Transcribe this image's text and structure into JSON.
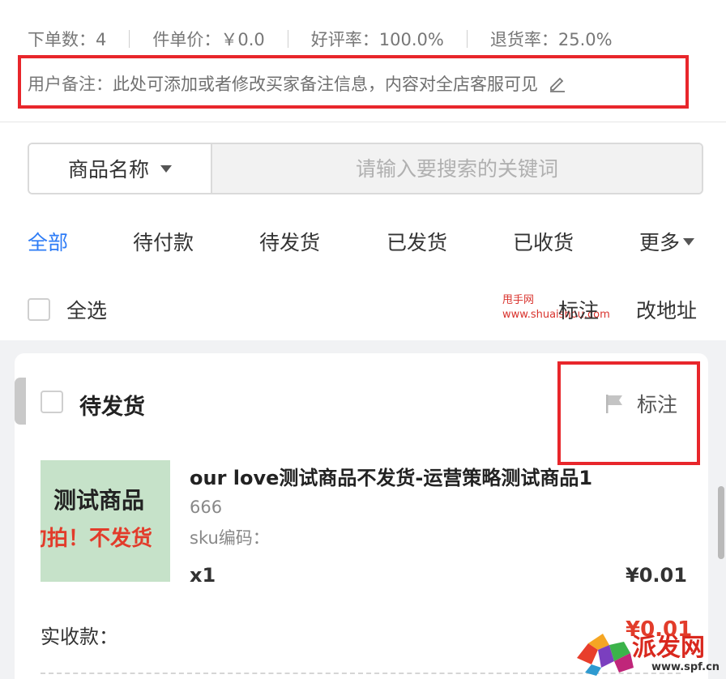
{
  "stats": [
    {
      "label": "下单数：4"
    },
    {
      "label": "件单价：￥0.0"
    },
    {
      "label": "好评率：100.0%"
    },
    {
      "label": "退货率：25.0%"
    }
  ],
  "remark": {
    "label": "用户备注：",
    "text": "此处可添加或者修改买家备注信息，内容对全店客服可见",
    "icon": "edit-icon"
  },
  "search": {
    "type_label": "商品名称",
    "placeholder": "请输入要搜索的关键词"
  },
  "tabs": [
    {
      "label": "全部",
      "active": true
    },
    {
      "label": "待付款"
    },
    {
      "label": "待发货"
    },
    {
      "label": "已发货"
    },
    {
      "label": "已收货"
    },
    {
      "label": "更多"
    }
  ],
  "select_row": {
    "select_all": "全选",
    "watermark_cn": "甩手网",
    "watermark_url": "www.shuaishou.com",
    "mark": "标注",
    "change_address": "改地址"
  },
  "order": {
    "status": "待发货",
    "mark_label": "标注",
    "product": {
      "thumb_line1": "测试商品",
      "thumb_line2": "勿拍！不发货",
      "title": "our love测试商品不发货-运营策略测试商品1",
      "subtitle": "666",
      "sku": "sku编码：",
      "qty": "x1",
      "price": "¥0.01"
    },
    "received_label": "实收款：",
    "received_amount": "¥0.01"
  },
  "watermark_logo": {
    "text": "派发网",
    "url": "www.spf.cn"
  },
  "colors": {
    "accent": "#2e7cf6",
    "highlight_red": "#e8262b",
    "price_red": "#e23c2b"
  }
}
